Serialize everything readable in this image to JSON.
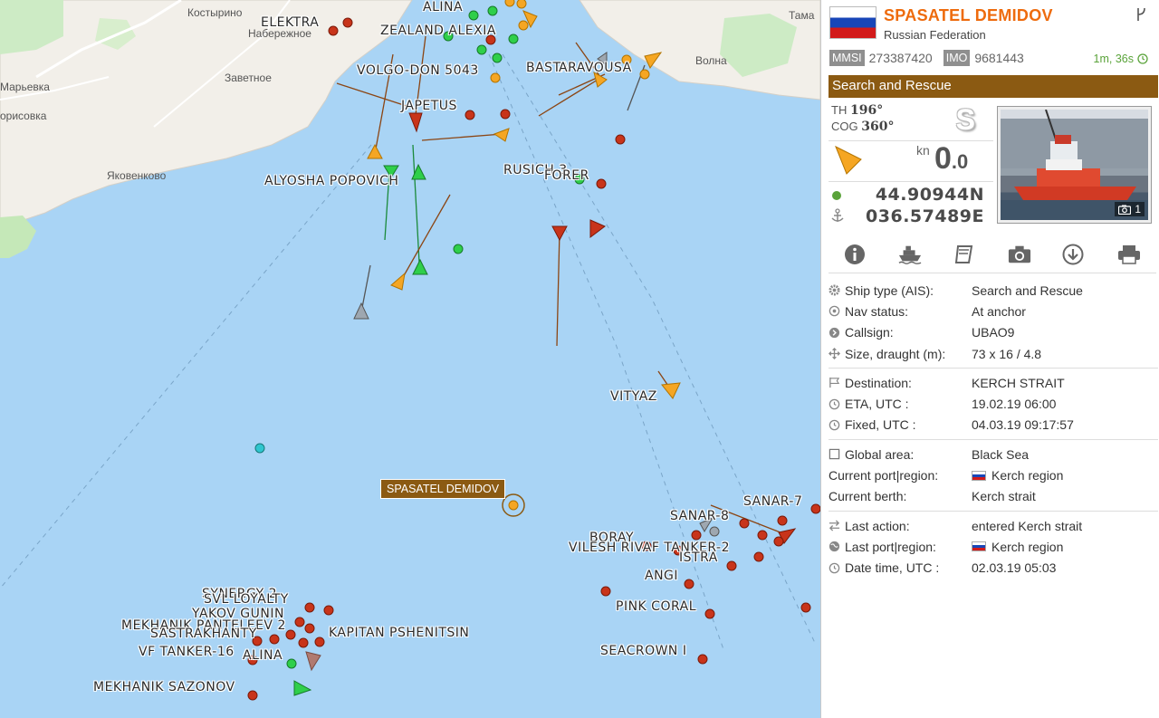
{
  "map": {
    "places": [
      {
        "name": "Костырино"
      },
      {
        "name": "Набережное"
      },
      {
        "name": "Марьевка"
      },
      {
        "name": "Заветное"
      },
      {
        "name": "орисовка"
      },
      {
        "name": "Яковенково"
      },
      {
        "name": "Волна"
      },
      {
        "name": "Тама"
      }
    ],
    "ship_labels": [
      "ALINA",
      "ELEKTRA",
      "ZEALAND ALEXIA",
      "VOLGO-DON 5043",
      "BASTA",
      "ARAVOUSA",
      "JAPETUS",
      "RUSICH 3",
      "FORER",
      "ALYOSHA POPOVICH",
      "VITYAZ",
      "SANAR-8",
      "SANAR-7",
      "BORAY",
      "VILESH RIVAF TANKER-2",
      "ISTRA",
      "ANGI",
      "PINK CORAL",
      "SEACROWN I",
      "SYNERGY 2",
      "SVL LOYALTY",
      "YAKOV GUNIN",
      "MEKHANIK PANTELEEV 2",
      "SASTRAKHANTY",
      "KAPITAN PSHENITSIN",
      "VF TANKER-16",
      "ALINA",
      "MEKHANIK SAZONOV"
    ],
    "selected_label": "SPASATEL DEMIDOV"
  },
  "panel": {
    "ship_name": "SPASATEL DEMIDOV",
    "country": "Russian Federation",
    "mmsi_tag": "MMSI",
    "mmsi": "273387420",
    "imo_tag": "IMO",
    "imo": "9681443",
    "age": "1m, 36s",
    "ship_type_header": "Search and Rescue",
    "th_label": "TH",
    "th_value": "196°",
    "cog_label": "COG",
    "cog_value": "360°",
    "status_letter": "S",
    "speed_unit": "kn",
    "speed_int": "0",
    "speed_dec": ".0",
    "lat": "44.90944N",
    "lon": "036.57489E",
    "photo_count": "1",
    "details": [
      {
        "key": "Ship type (AIS):",
        "value": "Search and Rescue"
      },
      {
        "key": "Nav status:",
        "value": "At anchor"
      },
      {
        "key": "Callsign:",
        "value": "UBAO9"
      },
      {
        "key": "Size, draught (m):",
        "value": "73 x 16 / 4.8"
      }
    ],
    "voyage": [
      {
        "key": "Destination:",
        "value": "KERCH STRAIT"
      },
      {
        "key": "ETA, UTC :",
        "value": "19.02.19 06:00"
      },
      {
        "key": "Fixed, UTC :",
        "value": "04.03.19 09:17:57"
      }
    ],
    "area": [
      {
        "key": "Global area:",
        "value": "Black Sea"
      },
      {
        "key": "Current port|region:",
        "value": "Kerch region"
      },
      {
        "key": "Current berth:",
        "value": "Kerch strait"
      }
    ],
    "last": [
      {
        "key": "Last action:",
        "value": "entered Kerch strait"
      },
      {
        "key": "Last port|region:",
        "value": "Kerch region"
      },
      {
        "key": "Date time, UTC :",
        "value": "02.03.19 05:03"
      }
    ]
  },
  "colors": {
    "sea": "#a9d4f5",
    "land": "#f2efe9",
    "accent_orange": "#ee6b0d",
    "type_bar": "#8b5a12",
    "ship_red": "#c8341a",
    "ship_green": "#2fcf4a",
    "ship_orange": "#f5a623"
  }
}
